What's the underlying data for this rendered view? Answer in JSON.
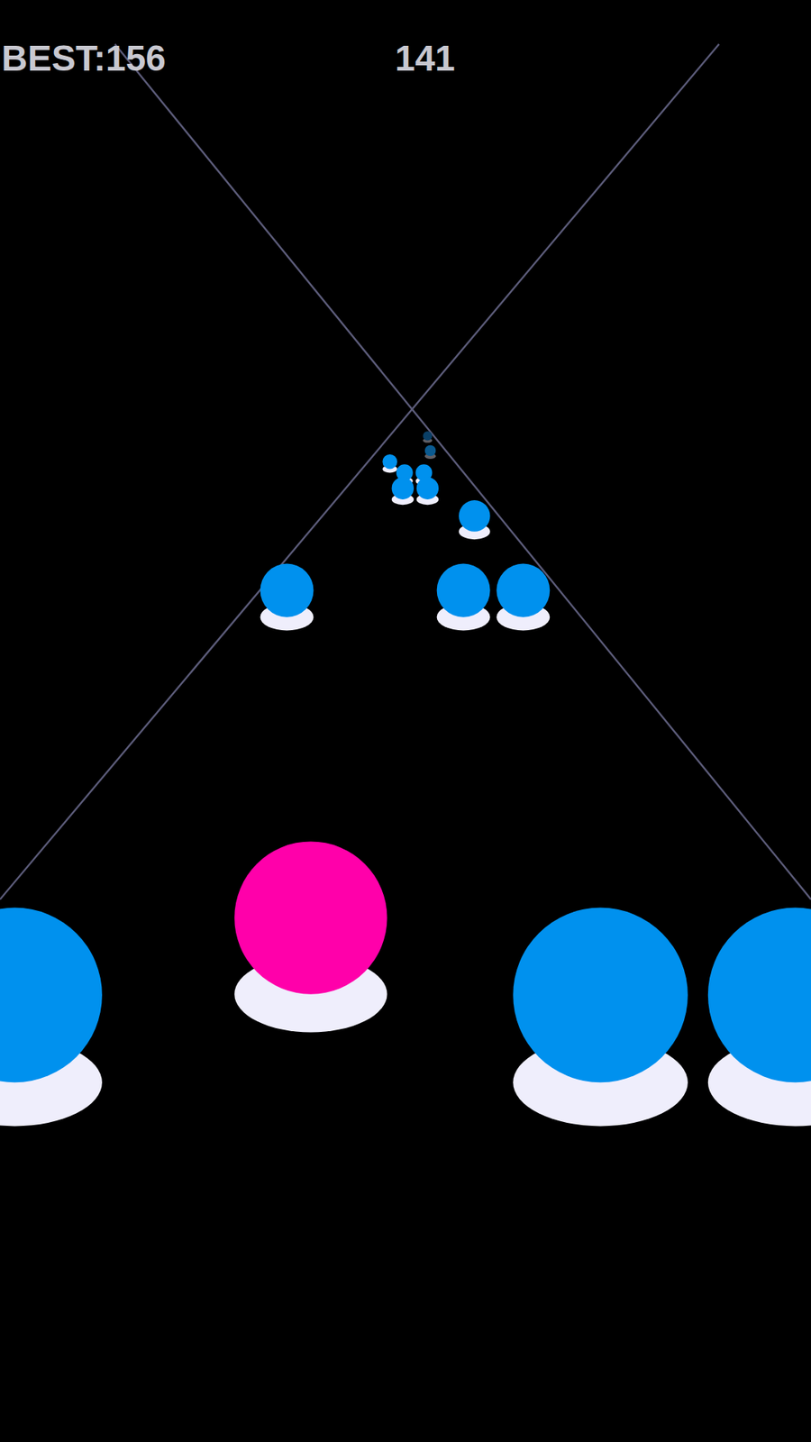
{
  "hud": {
    "best": "BEST:156",
    "score": "141"
  },
  "balls": [
    {
      "kind": "player",
      "color": "#ff00aa"
    },
    {
      "kind": "obstacle",
      "color": "#0091ee"
    },
    {
      "kind": "obstacle",
      "color": "#0091ee"
    },
    {
      "kind": "obstacle",
      "color": "#0091ee"
    },
    {
      "kind": "obstacle",
      "color": "#0091ee"
    },
    {
      "kind": "obstacle",
      "color": "#0091ee"
    },
    {
      "kind": "obstacle",
      "color": "#0091ee"
    },
    {
      "kind": "obstacle",
      "color": "#0091ee"
    },
    {
      "kind": "obstacle",
      "color": "#0091ee"
    },
    {
      "kind": "obstacle",
      "color": "#0091ee"
    },
    {
      "kind": "obstacle",
      "color": "#0091ee"
    },
    {
      "kind": "obstacle",
      "color": "#0091ee"
    },
    {
      "kind": "obstacle",
      "color": "#0091ee"
    },
    {
      "kind": "obstacle",
      "color": "#0a5a90"
    },
    {
      "kind": "obstacle",
      "color": "#0a3f66"
    }
  ]
}
